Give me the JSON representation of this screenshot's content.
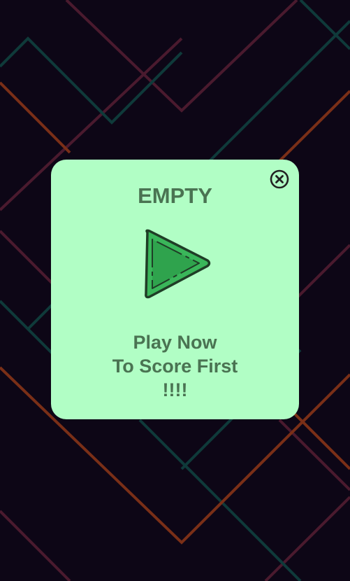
{
  "background": {
    "color": "#0d0616",
    "line_colors": [
      "#4a1a2e",
      "#0f3a3a",
      "#7a2f17"
    ]
  },
  "popup": {
    "background_color": "#b1fec5",
    "title": "EMPTY",
    "close_icon": "close-circle-icon",
    "play_icon": "play-triangle-icon",
    "message_lines": [
      "Play Now",
      "To Score First",
      "!!!!"
    ],
    "text_color": "#4a7352"
  }
}
